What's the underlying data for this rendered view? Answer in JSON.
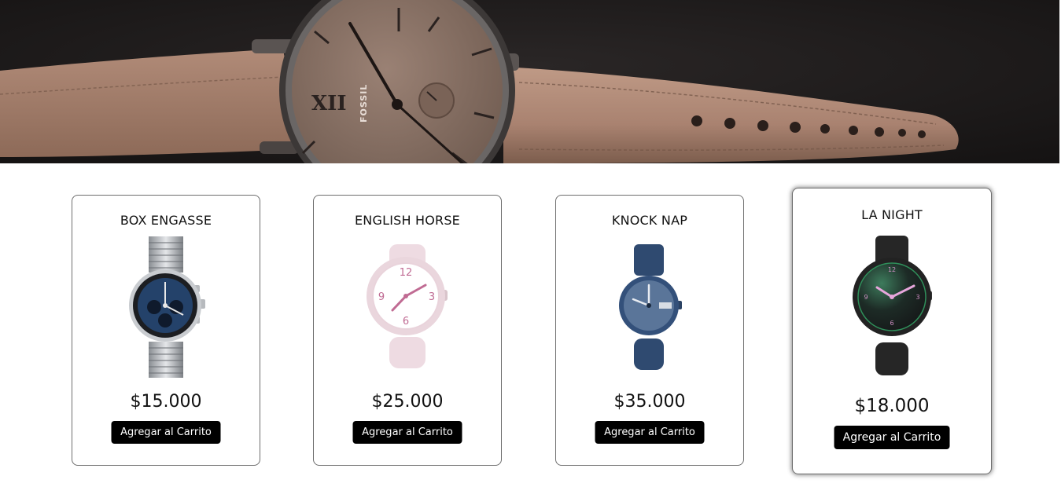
{
  "hero": {
    "brand_text": "FOSSIL",
    "numeral": "XII",
    "colors": {
      "background": "#1d1b1b",
      "strap": "#a98270",
      "dial": "#8c7467"
    }
  },
  "products": [
    {
      "name": "BOX ENGASSE",
      "price": "$15.000",
      "button_label": "Agregar al Carrito",
      "image_icon": "silver-chronograph-watch-icon"
    },
    {
      "name": "ENGLISH HORSE",
      "price": "$25.000",
      "button_label": "Agregar al Carrito",
      "image_icon": "pink-watch-icon"
    },
    {
      "name": "KNOCK NAP",
      "price": "$35.000",
      "button_label": "Agregar al Carrito",
      "image_icon": "navy-watch-icon"
    },
    {
      "name": "LA NIGHT",
      "price": "$18.000",
      "button_label": "Agregar al Carrito",
      "image_icon": "black-watch-icon"
    }
  ]
}
